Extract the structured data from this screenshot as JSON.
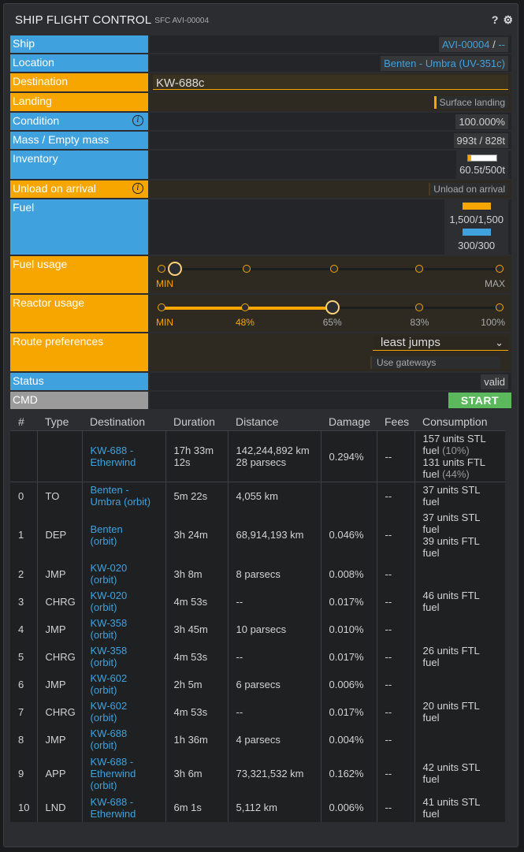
{
  "window": {
    "title": "SHIP FLIGHT CONTROL",
    "subtitle": "SFC AVI-00004",
    "help_glyph": "?",
    "settings_glyph": "⚙"
  },
  "form": {
    "ship": {
      "label": "Ship",
      "value": "AVI-00004",
      "separator": " / ",
      "extra": "--"
    },
    "location": {
      "label": "Location",
      "value": "Benten - Umbra (UV-351c)"
    },
    "destination": {
      "label": "Destination",
      "value": "KW-688c"
    },
    "landing": {
      "label": "Landing",
      "toggle": "Surface landing"
    },
    "condition": {
      "label": "Condition",
      "value": "100.000%"
    },
    "mass": {
      "label": "Mass / Empty mass",
      "value": "993t / 828t"
    },
    "inventory": {
      "label": "Inventory",
      "value": "60.5t/500t",
      "fill": 0.121
    },
    "unload": {
      "label": "Unload on arrival",
      "toggle": "Unload on arrival"
    },
    "fuel": {
      "label": "Fuel",
      "stl": "1,500/1,500",
      "ftl": "300/300",
      "stl_fill": 1.0,
      "ftl_fill": 1.0
    },
    "fuel_usage": {
      "label": "Fuel usage",
      "min": "MIN",
      "max": "MAX",
      "selected_index": 0,
      "stops": 5
    },
    "reactor_usage": {
      "label": "Reactor usage",
      "ticks": [
        "MIN",
        "48%",
        "65%",
        "83%",
        "100%"
      ],
      "selected_index": 2
    },
    "route": {
      "label": "Route preferences",
      "selected": "least jumps",
      "gateways": "Use gateways"
    },
    "status": {
      "label": "Status",
      "value": "valid"
    },
    "cmd": {
      "label": "CMD",
      "button": "START"
    }
  },
  "table": {
    "headers": [
      "#",
      "Type",
      "Destination",
      "Duration",
      "Distance",
      "Damage",
      "Fees",
      "Consumption"
    ],
    "summary": {
      "num": "",
      "type": "",
      "dest": [
        "KW-688 -",
        "Etherwind"
      ],
      "duration": [
        "17h 33m",
        "12s"
      ],
      "distance": [
        "142,244,892 km",
        "28 parsecs"
      ],
      "damage": "0.294%",
      "fees": "--",
      "consumption": [
        {
          "text": "157 units STL",
          "extra": ""
        },
        {
          "text": "fuel ",
          "extra": "(10%)"
        },
        {
          "text": "131 units FTL",
          "extra": ""
        },
        {
          "text": "fuel ",
          "extra": "(44%)"
        }
      ]
    },
    "rows": [
      {
        "num": "0",
        "type": "TO",
        "dest": [
          "Benten -",
          "Umbra (orbit)"
        ],
        "duration": "5m 22s",
        "distance": "4,055 km",
        "damage": "",
        "fees": "--",
        "consumption": [
          "37 units STL",
          "fuel"
        ]
      },
      {
        "num": "1",
        "type": "DEP",
        "dest": [
          "Benten",
          "(orbit)"
        ],
        "duration": "3h 24m",
        "distance": "68,914,193 km",
        "damage": "0.046%",
        "fees": "--",
        "consumption": [
          "37 units STL",
          "fuel",
          "39 units FTL",
          "fuel"
        ]
      },
      {
        "num": "2",
        "type": "JMP",
        "dest": [
          "KW-020",
          "(orbit)"
        ],
        "duration": "3h 8m",
        "distance": "8 parsecs",
        "damage": "0.008%",
        "fees": "--",
        "consumption": []
      },
      {
        "num": "3",
        "type": "CHRG",
        "dest": [
          "KW-020",
          "(orbit)"
        ],
        "duration": "4m 53s",
        "distance": "--",
        "damage": "0.017%",
        "fees": "--",
        "consumption": [
          "46 units FTL",
          "fuel"
        ]
      },
      {
        "num": "4",
        "type": "JMP",
        "dest": [
          "KW-358",
          "(orbit)"
        ],
        "duration": "3h 45m",
        "distance": "10 parsecs",
        "damage": "0.010%",
        "fees": "--",
        "consumption": []
      },
      {
        "num": "5",
        "type": "CHRG",
        "dest": [
          "KW-358",
          "(orbit)"
        ],
        "duration": "4m 53s",
        "distance": "--",
        "damage": "0.017%",
        "fees": "--",
        "consumption": [
          "26 units FTL",
          "fuel"
        ]
      },
      {
        "num": "6",
        "type": "JMP",
        "dest": [
          "KW-602",
          "(orbit)"
        ],
        "duration": "2h 5m",
        "distance": "6 parsecs",
        "damage": "0.006%",
        "fees": "--",
        "consumption": []
      },
      {
        "num": "7",
        "type": "CHRG",
        "dest": [
          "KW-602",
          "(orbit)"
        ],
        "duration": "4m 53s",
        "distance": "--",
        "damage": "0.017%",
        "fees": "--",
        "consumption": [
          "20 units FTL",
          "fuel"
        ]
      },
      {
        "num": "8",
        "type": "JMP",
        "dest": [
          "KW-688",
          "(orbit)"
        ],
        "duration": "1h 36m",
        "distance": "4 parsecs",
        "damage": "0.004%",
        "fees": "--",
        "consumption": []
      },
      {
        "num": "9",
        "type": "APP",
        "dest": [
          "KW-688 -",
          "Etherwind",
          "(orbit)"
        ],
        "duration": "3h 6m",
        "distance": "73,321,532 km",
        "damage": "0.162%",
        "fees": "--",
        "consumption": [
          "42 units STL",
          "fuel"
        ]
      },
      {
        "num": "10",
        "type": "LND",
        "dest": [
          "KW-688 -",
          "Etherwind"
        ],
        "duration": "6m 1s",
        "distance": "5,112 km",
        "damage": "0.006%",
        "fees": "--",
        "consumption": [
          "41 units STL",
          "fuel"
        ]
      }
    ]
  },
  "icons": {
    "info": "info-icon",
    "help": "help-icon",
    "settings": "gear-icon",
    "dropdown": "chevron-down-icon"
  }
}
